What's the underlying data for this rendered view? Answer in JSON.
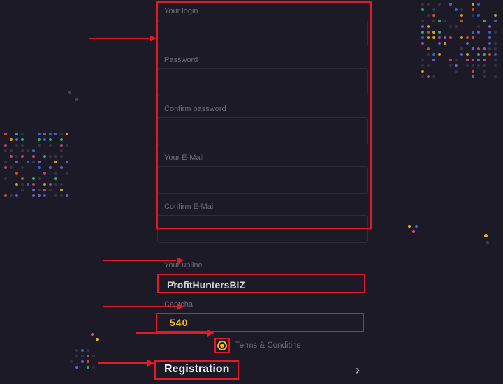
{
  "form": {
    "login_label": "Your login",
    "login_value": "",
    "password_label": "Password",
    "password_value": "",
    "confirm_password_label": "Confirm password",
    "confirm_password_value": "",
    "email_label": "Your E-Mail",
    "email_value": "",
    "confirm_email_label": "Confirm E-Mail",
    "confirm_email_value": ""
  },
  "upline": {
    "label": "Your upline",
    "value": "ProfitHuntersBIZ"
  },
  "captcha": {
    "label": "Captcha",
    "value": "540"
  },
  "terms": {
    "label": "Terms & Conditins",
    "checked": true
  },
  "submit": {
    "label": "Registration"
  }
}
